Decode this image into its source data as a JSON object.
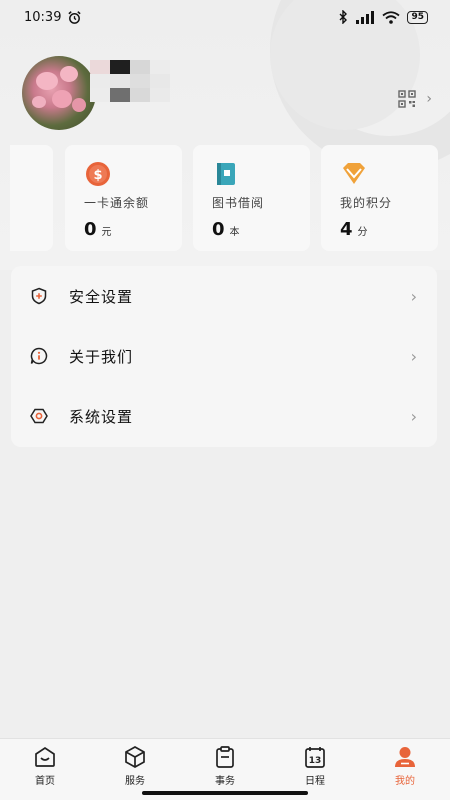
{
  "status_bar": {
    "time": "10:39",
    "battery": "95"
  },
  "profile": {
    "qr_chevron": "›"
  },
  "cards": [
    {
      "label": "一卡通余额",
      "value": "0",
      "unit": "元",
      "icon": "dollar-coin-icon",
      "color": "#e8643a"
    },
    {
      "label": "图书借阅",
      "value": "0",
      "unit": "本",
      "icon": "book-icon",
      "color": "#3aa6b9"
    },
    {
      "label": "我的积分",
      "value": "4",
      "unit": "分",
      "icon": "diamond-icon",
      "color": "#f0a23a"
    }
  ],
  "menu": [
    {
      "label": "安全设置",
      "icon": "shield-icon"
    },
    {
      "label": "关于我们",
      "icon": "info-bubble-icon"
    },
    {
      "label": "系统设置",
      "icon": "settings-icon"
    }
  ],
  "menu_chevron": "›",
  "nav": [
    {
      "label": "首页",
      "icon": "home-icon"
    },
    {
      "label": "服务",
      "icon": "cube-icon"
    },
    {
      "label": "事务",
      "icon": "clipboard-icon"
    },
    {
      "label": "日程",
      "icon": "calendar-icon"
    },
    {
      "label": "我的",
      "icon": "person-icon",
      "active": true
    }
  ],
  "colors": {
    "accent": "#e8643a"
  }
}
